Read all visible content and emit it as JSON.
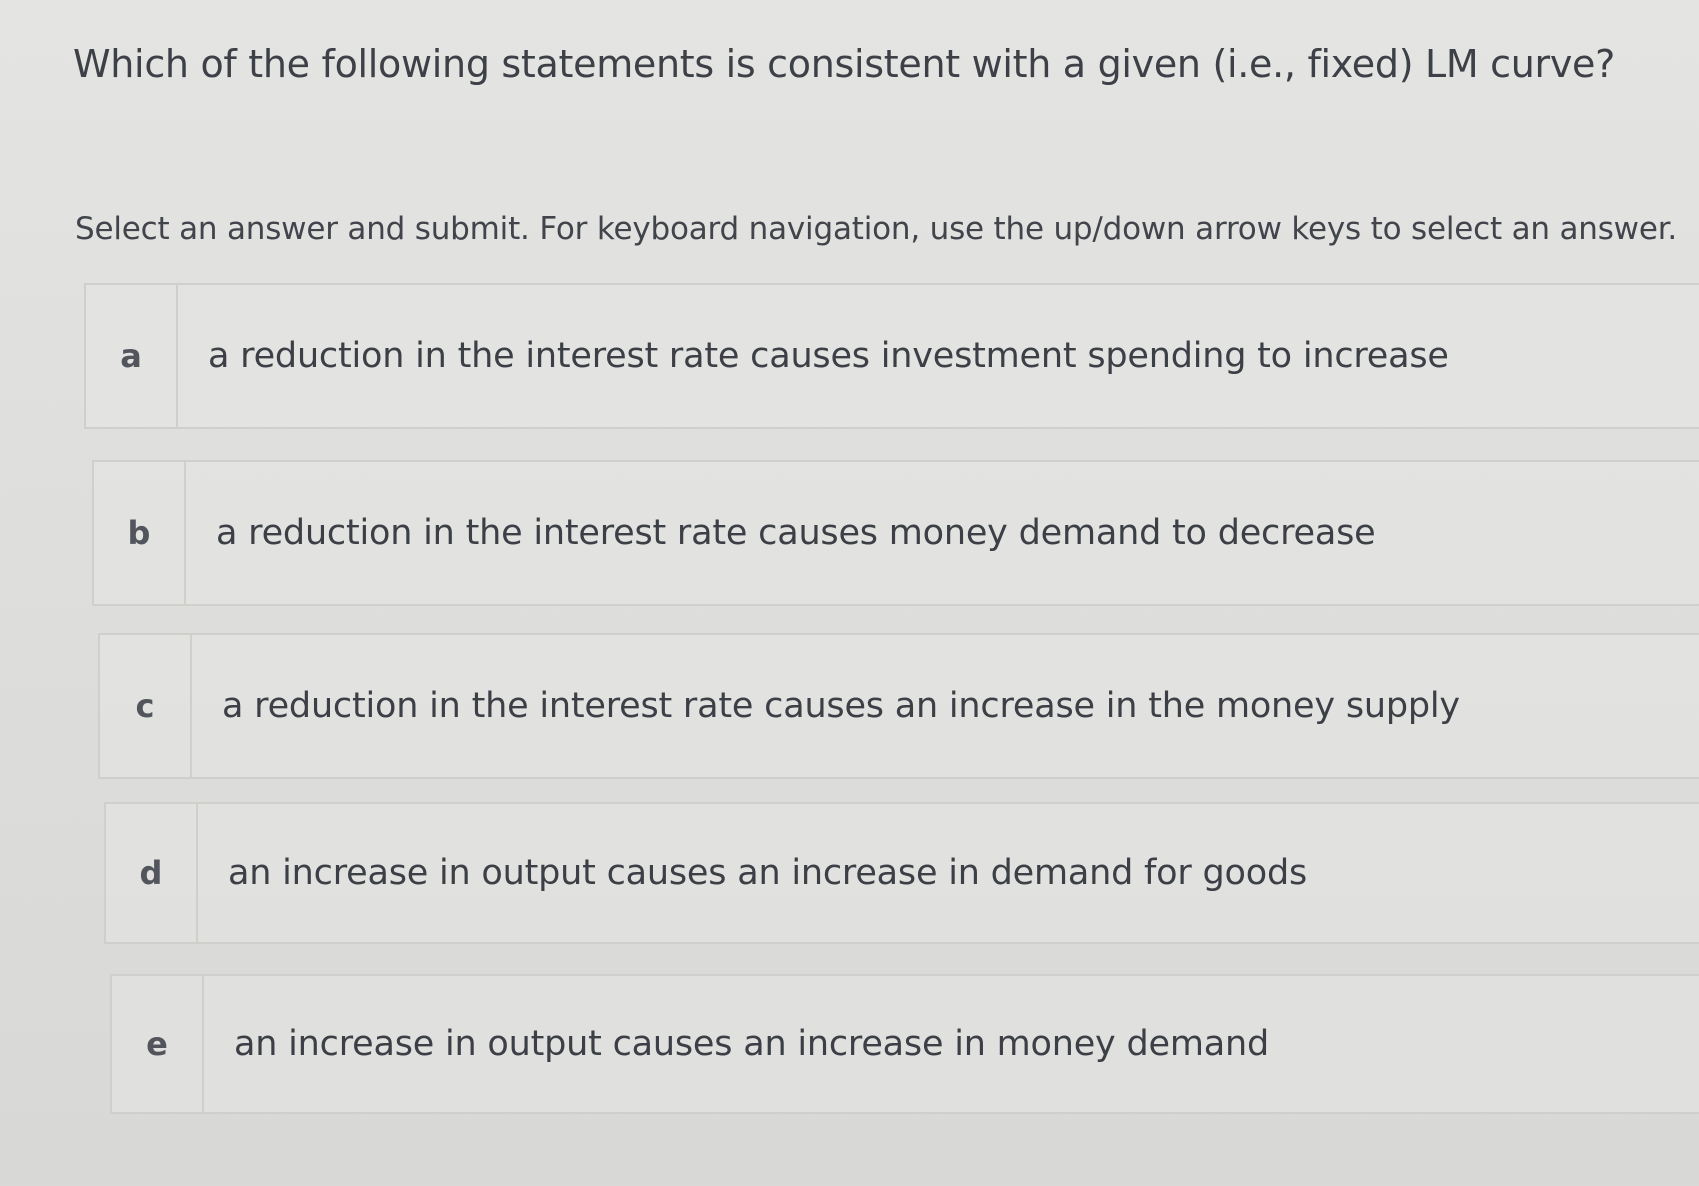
{
  "question": {
    "text": "Which of the following statements is consistent with a given (i.e., fixed) LM curve?"
  },
  "instructions": {
    "text": "Select an answer and submit. For keyboard navigation, use the up/down arrow keys to select an answer."
  },
  "options": [
    {
      "letter": "a",
      "text": "a reduction in the interest rate causes investment spending to increase"
    },
    {
      "letter": "b",
      "text": "a reduction in the interest rate causes money demand to decrease"
    },
    {
      "letter": "c",
      "text": "a reduction in the interest rate causes an increase in the money supply"
    },
    {
      "letter": "d",
      "text": "an increase in output causes an increase in demand for goods"
    },
    {
      "letter": "e",
      "text": "an increase in output causes an increase in money demand"
    }
  ]
}
